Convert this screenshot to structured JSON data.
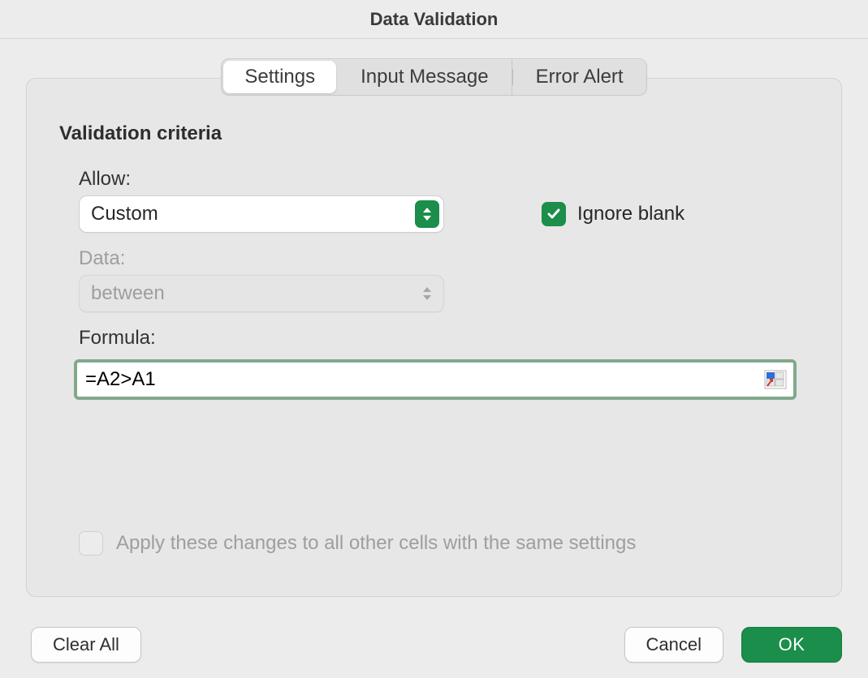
{
  "window": {
    "title": "Data Validation"
  },
  "tabs": [
    {
      "label": "Settings",
      "active": true
    },
    {
      "label": "Input Message",
      "active": false
    },
    {
      "label": "Error Alert",
      "active": false
    }
  ],
  "section": {
    "title": "Validation criteria"
  },
  "allow": {
    "label": "Allow:",
    "selected": "Custom"
  },
  "ignore_blank": {
    "label": "Ignore blank",
    "checked": true
  },
  "data_field": {
    "label": "Data:",
    "selected": "between",
    "enabled": false
  },
  "formula": {
    "label": "Formula:",
    "value": "=A2>A1"
  },
  "apply_all": {
    "label": "Apply these changes to all other cells with the same settings",
    "checked": false,
    "enabled": false
  },
  "buttons": {
    "clear_all": "Clear All",
    "cancel": "Cancel",
    "ok": "OK"
  }
}
